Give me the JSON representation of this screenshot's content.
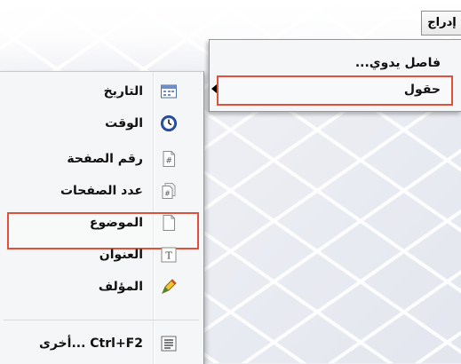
{
  "menubar": {
    "insert_label": "إدراج"
  },
  "insert_menu": {
    "items": [
      {
        "label": "فاصل يدوي..."
      },
      {
        "label": "حقول"
      }
    ]
  },
  "fields_submenu": {
    "items": [
      {
        "label": "التاريخ",
        "icon": "calendar-icon"
      },
      {
        "label": "الوقت",
        "icon": "clock-icon"
      },
      {
        "label": "رقم الصفحة",
        "icon": "page-number-icon"
      },
      {
        "label": "عدد الصفحات",
        "icon": "page-count-icon"
      },
      {
        "label": "الموضوع",
        "icon": "document-icon"
      },
      {
        "label": "العنوان",
        "icon": "title-icon"
      },
      {
        "label": "المؤلف",
        "icon": "pen-icon"
      },
      {
        "label": "أخرى... Ctrl+F2",
        "icon": "list-icon"
      }
    ]
  },
  "colors": {
    "highlight": "#e2503b"
  }
}
